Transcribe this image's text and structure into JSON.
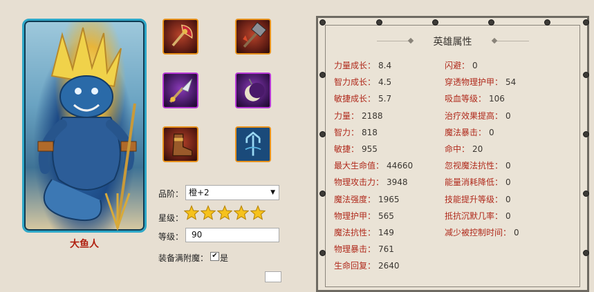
{
  "hero": {
    "name": "大鱼人"
  },
  "equipment": [
    {
      "icon": "blood-axe-icon",
      "rarity": "orange"
    },
    {
      "icon": "war-hammer-icon",
      "rarity": "orange"
    },
    {
      "icon": "spear-tip-icon",
      "rarity": "purple"
    },
    {
      "icon": "crescent-moon-icon",
      "rarity": "purple"
    },
    {
      "icon": "leather-boots-icon",
      "rarity": "orange"
    },
    {
      "icon": "trident-emblem-icon",
      "rarity": "orange"
    }
  ],
  "form": {
    "quality_label": "品阶：",
    "quality_value": "橙+2",
    "star_label": "星级：",
    "stars": 5,
    "level_label": "等级：",
    "level_value": "90",
    "enchant_label": "装备满附魔：",
    "enchant_checked": true,
    "enchant_yes": "是"
  },
  "colors": {
    "attr_key": "#b02a1c",
    "accent": "#2fa8c8",
    "orange_border": "#e8921c",
    "purple_border": "#b83ad6"
  },
  "panel": {
    "title": "英雄属性",
    "left": [
      {
        "k": "力量成长：",
        "v": "8.4"
      },
      {
        "k": "智力成长：",
        "v": "4.5"
      },
      {
        "k": "敏捷成长：",
        "v": "5.7"
      },
      {
        "k": "力量：",
        "v": "2188"
      },
      {
        "k": "智力：",
        "v": "818"
      },
      {
        "k": "敏捷：",
        "v": "955"
      },
      {
        "k": "最大生命值：",
        "v": "44660"
      },
      {
        "k": "物理攻击力：",
        "v": "3948"
      },
      {
        "k": "魔法强度：",
        "v": "1965"
      },
      {
        "k": "物理护甲：",
        "v": "565"
      },
      {
        "k": "魔法抗性：",
        "v": "149"
      },
      {
        "k": "物理暴击：",
        "v": "761"
      },
      {
        "k": "生命回复：",
        "v": "2640"
      }
    ],
    "right": [
      {
        "k": "闪避：",
        "v": "0"
      },
      {
        "k": "穿透物理护甲：",
        "v": "54"
      },
      {
        "k": "吸血等级：",
        "v": "106"
      },
      {
        "k": "治疗效果提高：",
        "v": "0"
      },
      {
        "k": "魔法暴击：",
        "v": "0"
      },
      {
        "k": "命中：",
        "v": "20"
      },
      {
        "k": "忽视魔法抗性：",
        "v": "0"
      },
      {
        "k": "能量消耗降低：",
        "v": "0"
      },
      {
        "k": "技能提升等级：",
        "v": "0"
      },
      {
        "k": "抵抗沉默几率：",
        "v": "0"
      },
      {
        "k": "减少被控制时间：",
        "v": "0"
      }
    ]
  }
}
